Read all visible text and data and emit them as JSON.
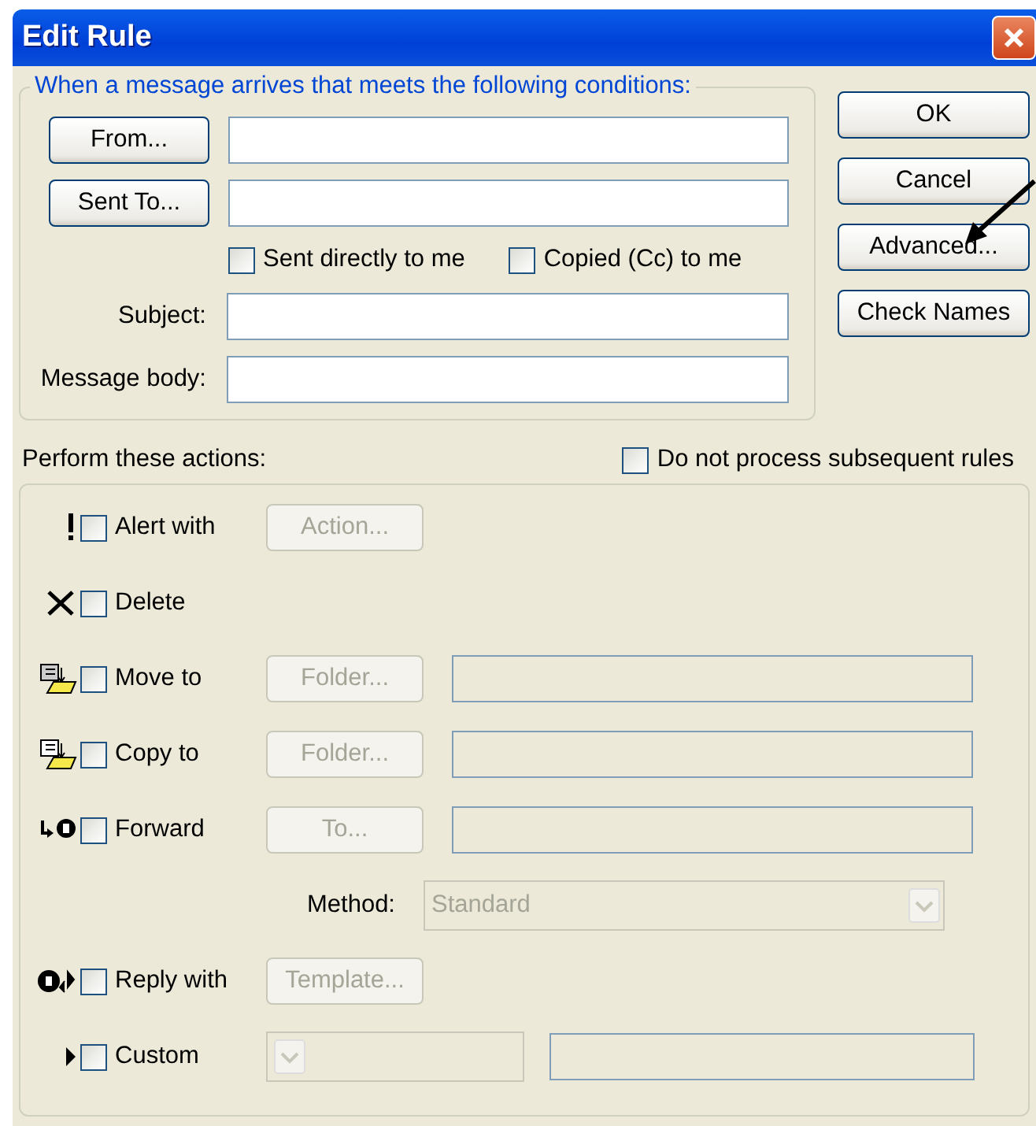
{
  "window": {
    "title": "Edit Rule"
  },
  "conditions": {
    "legend": "When a message arrives that meets the following conditions:",
    "address_rows": [
      {
        "button": "From..."
      },
      {
        "button": "Sent To..."
      }
    ],
    "checkboxes": [
      {
        "label": "Sent directly to me",
        "checked": false
      },
      {
        "label": "Copied (Cc) to me",
        "checked": false
      }
    ],
    "text_rows": [
      {
        "label": "Subject:"
      },
      {
        "label": "Message body:"
      }
    ]
  },
  "buttons": [
    {
      "label": "OK"
    },
    {
      "label": "Cancel"
    },
    {
      "label": "Advanced..."
    },
    {
      "label": "Check Names"
    }
  ],
  "actions_label": "Perform these actions:",
  "stop_rule": {
    "label": "Do not process subsequent rules",
    "checked": false
  },
  "actions": [
    {
      "kind": "check",
      "label": "Alert with",
      "checked": false,
      "button": {
        "label": "Action...",
        "disabled": true
      }
    },
    {
      "kind": "check",
      "label": "Delete",
      "checked": false
    },
    {
      "kind": "check",
      "label": "Move to",
      "checked": false,
      "button": {
        "label": "Folder...",
        "disabled": true
      },
      "field": {
        "disabled": true
      }
    },
    {
      "kind": "check",
      "label": "Copy to",
      "checked": false,
      "button": {
        "label": "Folder...",
        "disabled": true
      },
      "field": {
        "disabled": true
      }
    },
    {
      "kind": "check",
      "label": "Forward",
      "checked": false,
      "button": {
        "label": "To...",
        "disabled": true
      },
      "field": {
        "disabled": true
      }
    },
    {
      "kind": "method",
      "label": "Method:",
      "value": "Standard",
      "disabled": true
    },
    {
      "kind": "check",
      "label": "Reply with",
      "checked": false,
      "button": {
        "label": "Template...",
        "disabled": true
      }
    },
    {
      "kind": "custom",
      "label": "Custom",
      "checked": false,
      "combo": {
        "disabled": true
      },
      "field": {
        "disabled": true
      }
    }
  ]
}
